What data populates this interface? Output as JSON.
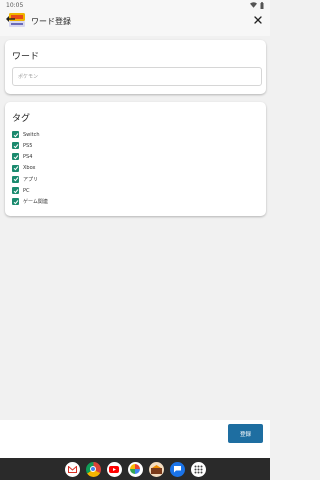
{
  "status": {
    "time": "10:05"
  },
  "app_bar": {
    "title": "ワード登録"
  },
  "word_card": {
    "title": "ワード",
    "input_placeholder": "ポケモン",
    "input_value": ""
  },
  "tag_card": {
    "title": "タグ",
    "tags": [
      {
        "label": "Switch",
        "checked": true
      },
      {
        "label": "PS5",
        "checked": true
      },
      {
        "label": "PS4",
        "checked": true
      },
      {
        "label": "Xbox",
        "checked": true
      },
      {
        "label": "アプリ",
        "checked": true
      },
      {
        "label": "PC",
        "checked": true
      },
      {
        "label": "ゲーム関連",
        "checked": true
      }
    ]
  },
  "footer": {
    "register_label": "登録"
  },
  "colors": {
    "checkbox": "#1a8a6e",
    "register_button": "#1e6ea1",
    "nav_bar": "#2a2a2a"
  },
  "dock": [
    "gmail-icon",
    "chrome-icon",
    "youtube-icon",
    "photos-icon",
    "game-app-icon",
    "messages-icon",
    "app-drawer-icon"
  ]
}
